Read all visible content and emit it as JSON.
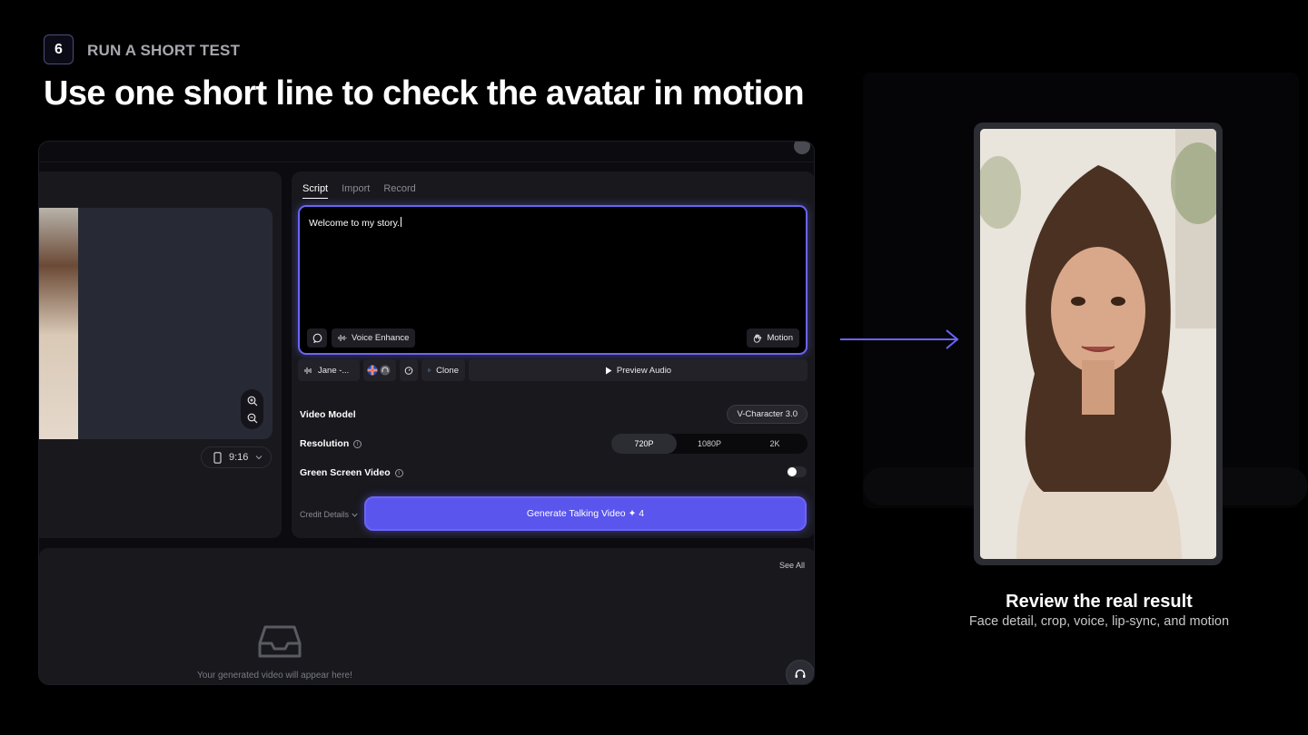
{
  "step": {
    "number": "6",
    "label": "RUN A SHORT TEST"
  },
  "headline": "Use one short line to check the avatar in motion",
  "app": {
    "ratio": "9:16",
    "tabs": [
      {
        "label": "Script",
        "active": true
      },
      {
        "label": "Import",
        "active": false
      },
      {
        "label": "Record",
        "active": false
      }
    ],
    "script_text": "Welcome to my story.",
    "voice_enhance_label": "Voice Enhance",
    "motion_label": "Motion",
    "voice_name": "Jane -...",
    "clone_label": "Clone",
    "preview_audio_label": "Preview Audio",
    "video_model_label": "Video Model",
    "video_model_value": "V-Character 3.0",
    "resolution_label": "Resolution",
    "resolution_options": [
      "720P",
      "1080P",
      "2K"
    ],
    "resolution_selected": "720P",
    "green_screen_label": "Green Screen Video",
    "green_screen_on": false,
    "credit_details_label": "Credit Details",
    "generate_label": "Generate Talking Video ✦ 4",
    "see_all_label": "See All",
    "empty_text": "Your generated video will appear here!"
  },
  "result": {
    "title": "Review the real result",
    "subtitle": "Face detail, crop, voice, lip-sync, and motion"
  },
  "colors": {
    "accent": "#6b64f5",
    "button": "#5a55ec",
    "panel": "#18181d"
  }
}
